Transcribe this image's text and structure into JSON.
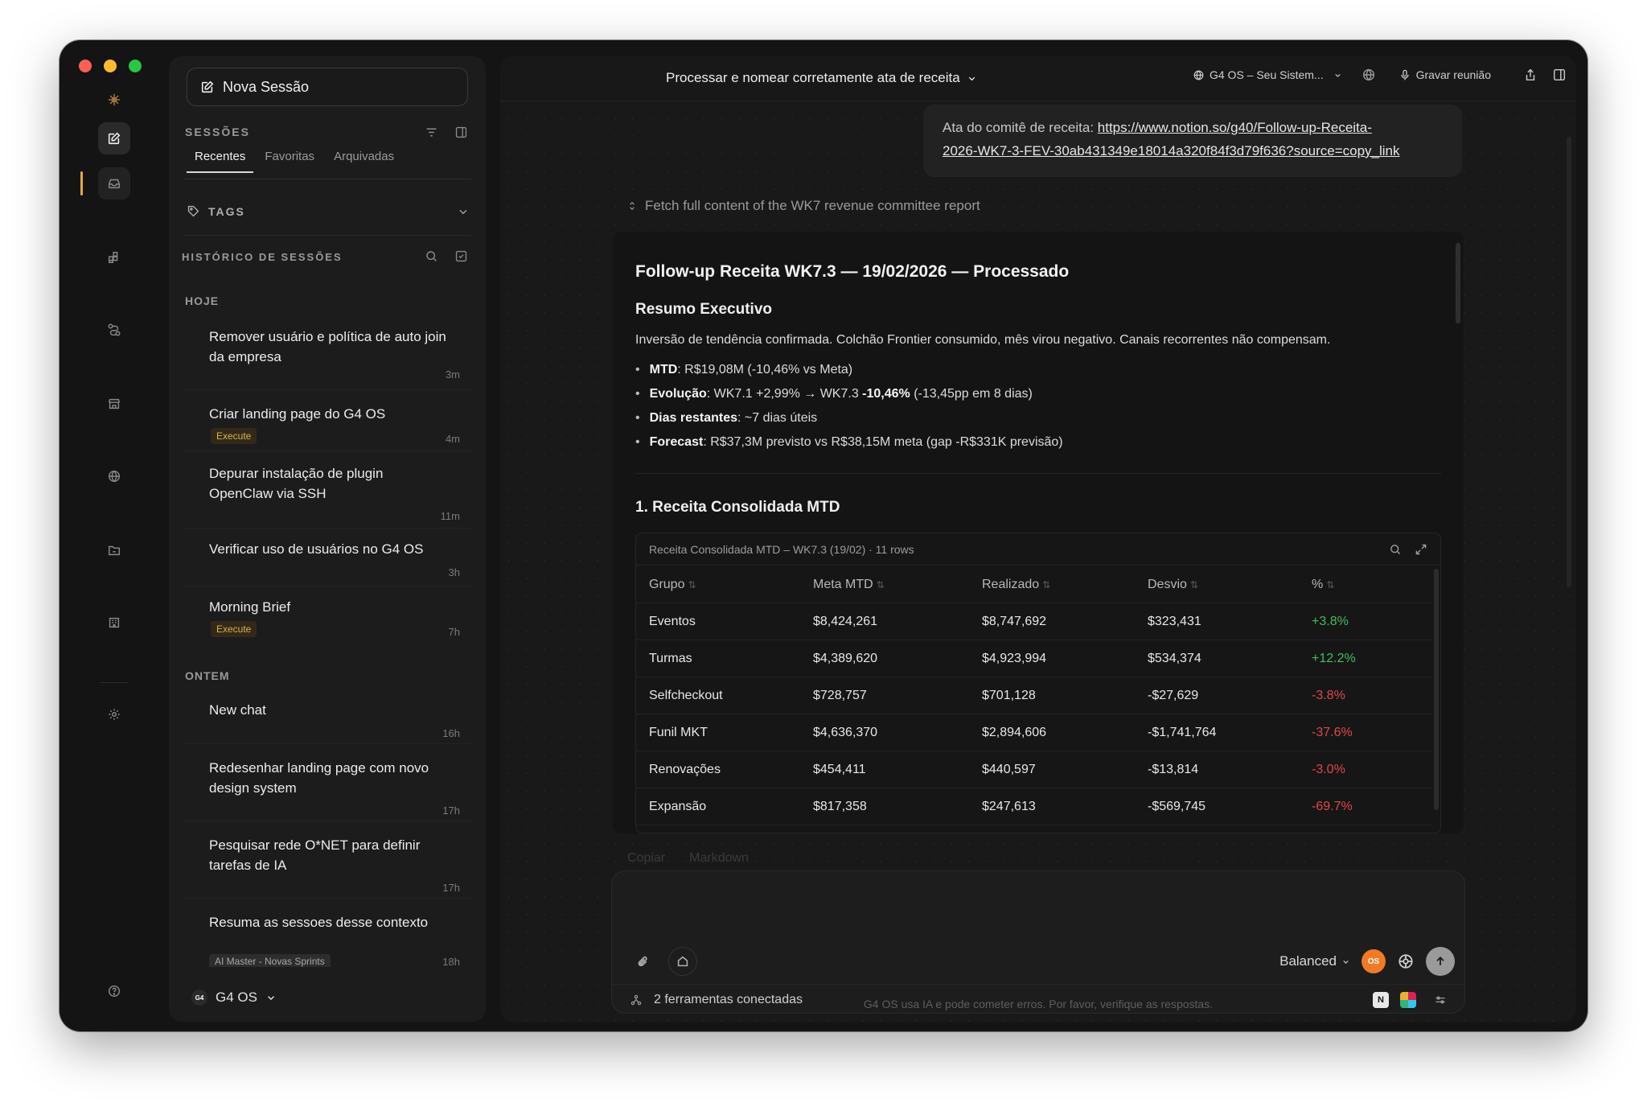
{
  "sidebar": {
    "new_session_label": "Nova Sessão",
    "sessions_heading": "SESSÕES",
    "tabs": [
      "Recentes",
      "Favoritas",
      "Arquivadas"
    ],
    "tags_label": "TAGS",
    "history_heading": "HISTÓRICO DE SESSÕES",
    "groups": {
      "today": "HOJE",
      "yesterday": "ONTEM"
    },
    "items": [
      {
        "title": "Remover usuário e política de auto join da empresa",
        "time": "3m"
      },
      {
        "title": "Criar landing page do G4 OS",
        "badge": "Execute",
        "time": "4m"
      },
      {
        "title": "Depurar instalação de plugin OpenClaw via SSH",
        "time": "11m"
      },
      {
        "title": "Verificar uso de usuários no G4 OS",
        "time": "3h"
      },
      {
        "title": "Morning Brief",
        "badge": "Execute",
        "time": "7h"
      },
      {
        "title": "New chat",
        "time": "16h"
      },
      {
        "title": "Redesenhar landing page com novo design system",
        "time": "17h"
      },
      {
        "title": "Pesquisar rede O*NET para definir tarefas de IA",
        "time": "17h"
      },
      {
        "title": "Resuma as sessoes desse contexto",
        "tag": "AI Master - Novas Sprints",
        "time": "18h"
      }
    ],
    "workspace": {
      "logo": "G4",
      "name": "G4 OS"
    }
  },
  "topbar": {
    "title": "Processar e nomear corretamente ata de receita",
    "workspace_selector": "G4 OS – Seu Sistem...",
    "record_label": "Gravar reunião"
  },
  "message": {
    "prefix": "Ata do comitê de receita: ",
    "link_line1": "https://www.notion.so/g40/Follow-up-Receita-",
    "link_line2": "2026-WK7-3-FEV-30ab431349e18014a320f84f3d79f636?source=copy_link"
  },
  "tool_step": "Fetch full content of the WK7 revenue committee report",
  "report": {
    "title": "Follow-up Receita WK7.3 — 19/02/2026 — Processado",
    "summary_heading": "Resumo Executivo",
    "summary_text": "Inversão de tendência confirmada. Colchão Frontier consumido, mês virou negativo. Canais recorrentes não compensam.",
    "bullets": [
      {
        "label": "MTD",
        "pre": ": R$19,08M (-10,46% vs Meta)",
        "bold": "",
        "post": ""
      },
      {
        "label": "Evolução",
        "pre": ": WK7.1 +2,99% → WK7.3 ",
        "bold": "-10,46%",
        "post": " (-13,45pp em 8 dias)"
      },
      {
        "label": "Dias restantes",
        "pre": ": ~7 dias úteis",
        "bold": "",
        "post": ""
      },
      {
        "label": "Forecast",
        "pre": ": R$37,3M previsto vs R$38,15M meta (gap -R$331K previsão)",
        "bold": "",
        "post": ""
      }
    ],
    "section_heading": "1. Receita Consolidada MTD",
    "table_caption": "Receita Consolidada MTD – WK7.3 (19/02) · 11 rows",
    "columns": [
      "Grupo",
      "Meta MTD",
      "Realizado",
      "Desvio",
      "%"
    ],
    "rows": [
      [
        "Eventos",
        "$8,424,261",
        "$8,747,692",
        "$323,431",
        "+3.8%"
      ],
      [
        "Turmas",
        "$4,389,620",
        "$4,923,994",
        "$534,374",
        "+12.2%"
      ],
      [
        "Selfcheckout",
        "$728,757",
        "$701,128",
        "-$27,629",
        "-3.8%"
      ],
      [
        "Funil MKT",
        "$4,636,370",
        "$2,894,606",
        "-$1,741,764",
        "-37.6%"
      ],
      [
        "Renovações",
        "$454,411",
        "$440,597",
        "-$13,814",
        "-3.0%"
      ],
      [
        "Expansão",
        "$817,358",
        "$247,613",
        "-$569,745",
        "-69.7%"
      ]
    ],
    "copy_label": "Copiar",
    "markdown_label": "Markdown"
  },
  "composer": {
    "mode_label": "Balanced",
    "os_badge": "OS",
    "tools_connected": "2 ferramentas conectadas",
    "disclaimer": "G4 OS usa IA e pode cometer erros. Por favor, verifique as respostas."
  },
  "colors": {
    "accent": "#e6a93c",
    "positive": "#3fbf5f",
    "negative": "#e0474c",
    "os_orange": "#f07a26"
  }
}
